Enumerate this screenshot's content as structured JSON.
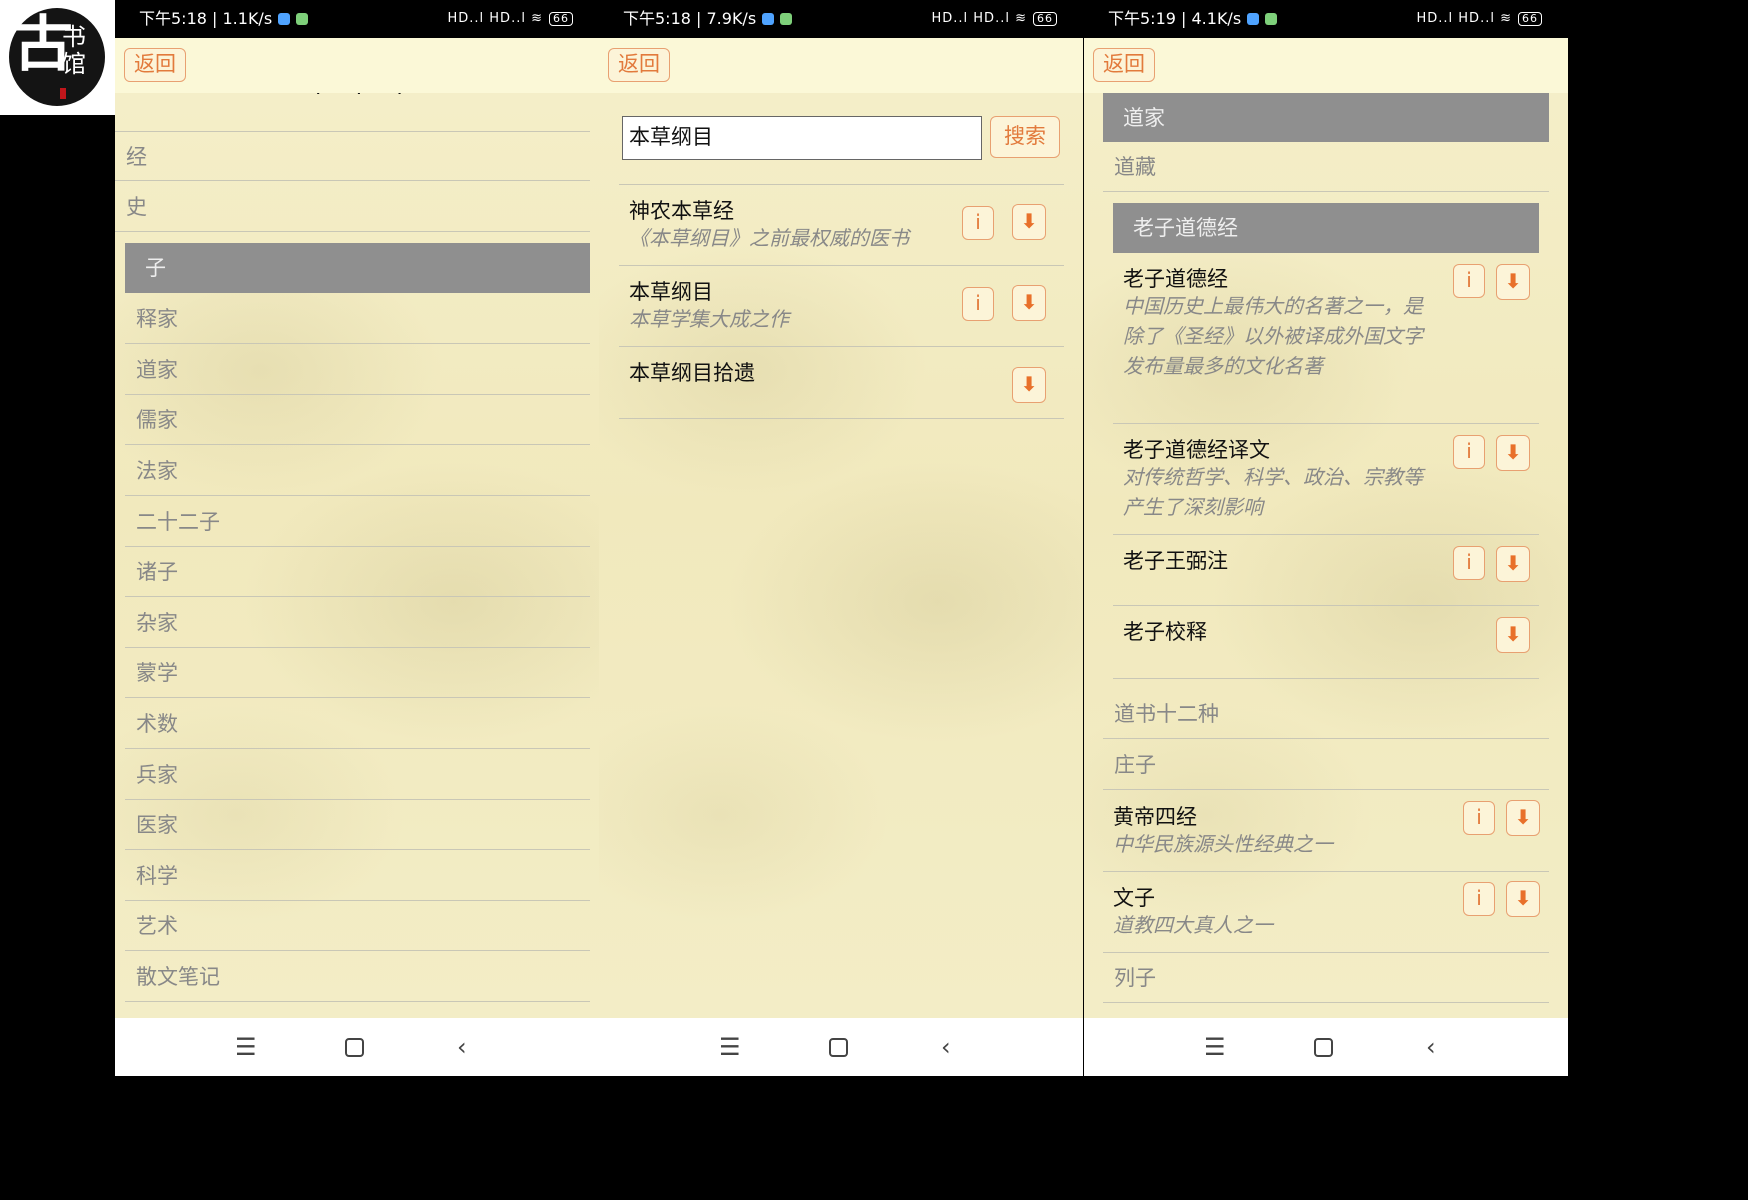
{
  "logo": {
    "main_char": "古",
    "side_chars": "书馆"
  },
  "screens": [
    {
      "status": {
        "time": "下午5:18 | 1.1K/s",
        "signal": "HD..l HD..l",
        "battery": "66"
      },
      "back_label": "返回",
      "cut_text": "·  ·  ·",
      "rows_top": [
        "经",
        "史"
      ],
      "section_header": "子",
      "rows": [
        "释家",
        "道家",
        "儒家",
        "法家",
        "二十二子",
        "诸子",
        "杂家",
        "蒙学",
        "术数",
        "兵家",
        "医家",
        "科学",
        "艺术",
        "散文笔记"
      ]
    },
    {
      "status": {
        "time": "下午5:18 | 7.9K/s",
        "signal": "HD..l HD..l",
        "battery": "66"
      },
      "back_label": "返回",
      "search": {
        "value": "本草纲目",
        "button": "搜索"
      },
      "results": [
        {
          "title": "神农本草经",
          "desc": "《本草纲目》之前最权威的医书"
        },
        {
          "title": "本草纲目",
          "desc": "本草学集大成之作"
        },
        {
          "title": "本草纲目拾遗",
          "desc": ""
        }
      ]
    },
    {
      "status": {
        "time": "下午5:19 | 4.1K/s",
        "signal": "HD..l HD..l",
        "battery": "66"
      },
      "back_label": "返回",
      "header_main": "道家",
      "row_daozang": "道藏",
      "header_sub": "老子道德经",
      "books_sub": [
        {
          "title": "老子道德经",
          "desc": "中国历史上最伟大的名著之一，是除了《圣经》以外被译成外国文字发布量最多的文化名著"
        },
        {
          "title": "老子道德经译文",
          "desc": "对传统哲学、科学、政治、宗教等产生了深刻影响"
        },
        {
          "title": "老子王弼注",
          "desc": ""
        },
        {
          "title": "老子校释",
          "desc": ""
        }
      ],
      "rows_after": [
        "道书十二种",
        "庄子"
      ],
      "books_main": [
        {
          "title": "黄帝四经",
          "desc": "中华民族源头性经典之一"
        },
        {
          "title": "文子",
          "desc": "道教四大真人之一"
        }
      ],
      "row_last": "列子"
    }
  ],
  "icons": {
    "info": "i",
    "download": "⬇",
    "menu": "☰",
    "back_nav": "‹"
  }
}
